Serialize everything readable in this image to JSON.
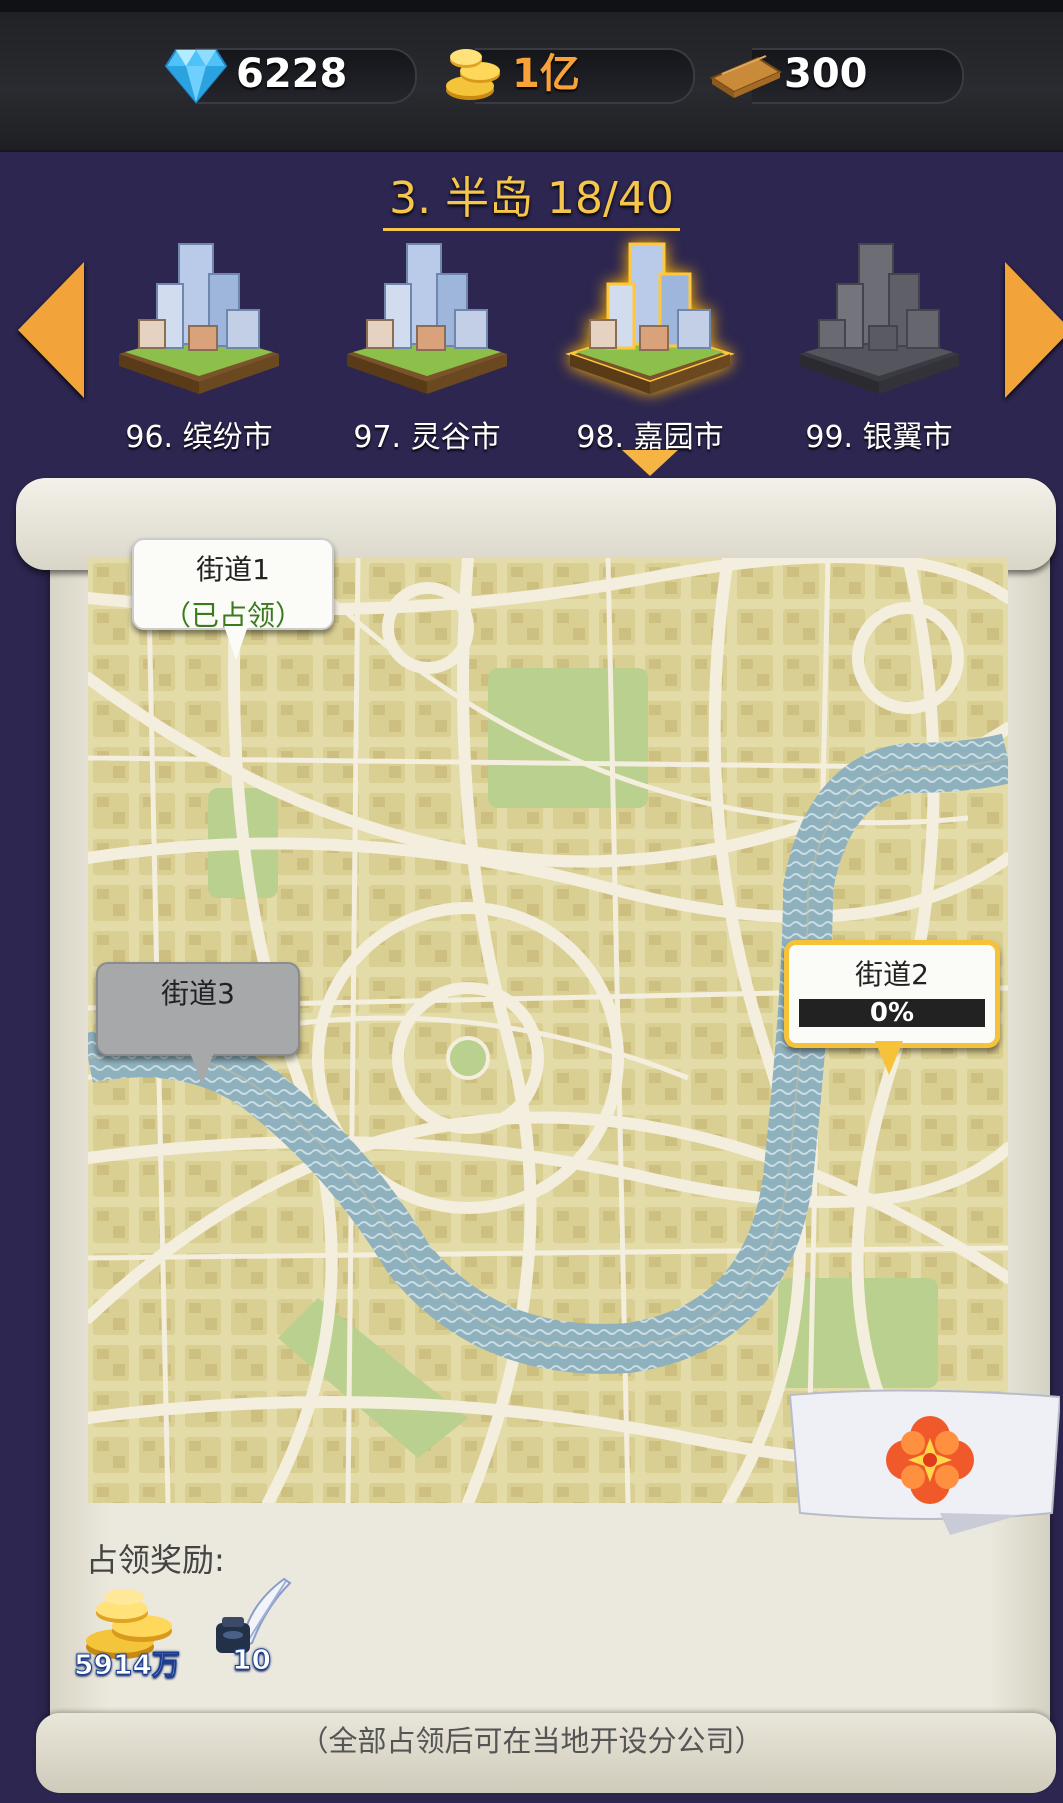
{
  "resources": {
    "gems": "6228",
    "coins": "1亿",
    "wood": "300"
  },
  "region_title": "3. 半岛 18/40",
  "cities": [
    {
      "label": "96. 缤纷市",
      "state": "unlocked"
    },
    {
      "label": "97. 灵谷市",
      "state": "unlocked"
    },
    {
      "label": "98. 嘉园市",
      "state": "selected"
    },
    {
      "label": "99. 银翼市",
      "state": "locked"
    }
  ],
  "streets": [
    {
      "name": "街道1",
      "status": "（已占领）"
    },
    {
      "name": "街道2",
      "progress": "0%"
    },
    {
      "name": "街道3"
    }
  ],
  "rewards": {
    "label": "占领奖励:",
    "items": [
      {
        "icon": "gold-coins-icon",
        "qty": "5914万"
      },
      {
        "icon": "ink-quill-icon",
        "qty": "10"
      }
    ]
  },
  "footer_note": "（全部占领后可在当地开设分公司）",
  "colors": {
    "background": "#2c2650",
    "accent_gold": "#f6c64a",
    "highlight_border": "#f5c23a",
    "occupied_text": "#3c7a1e"
  }
}
